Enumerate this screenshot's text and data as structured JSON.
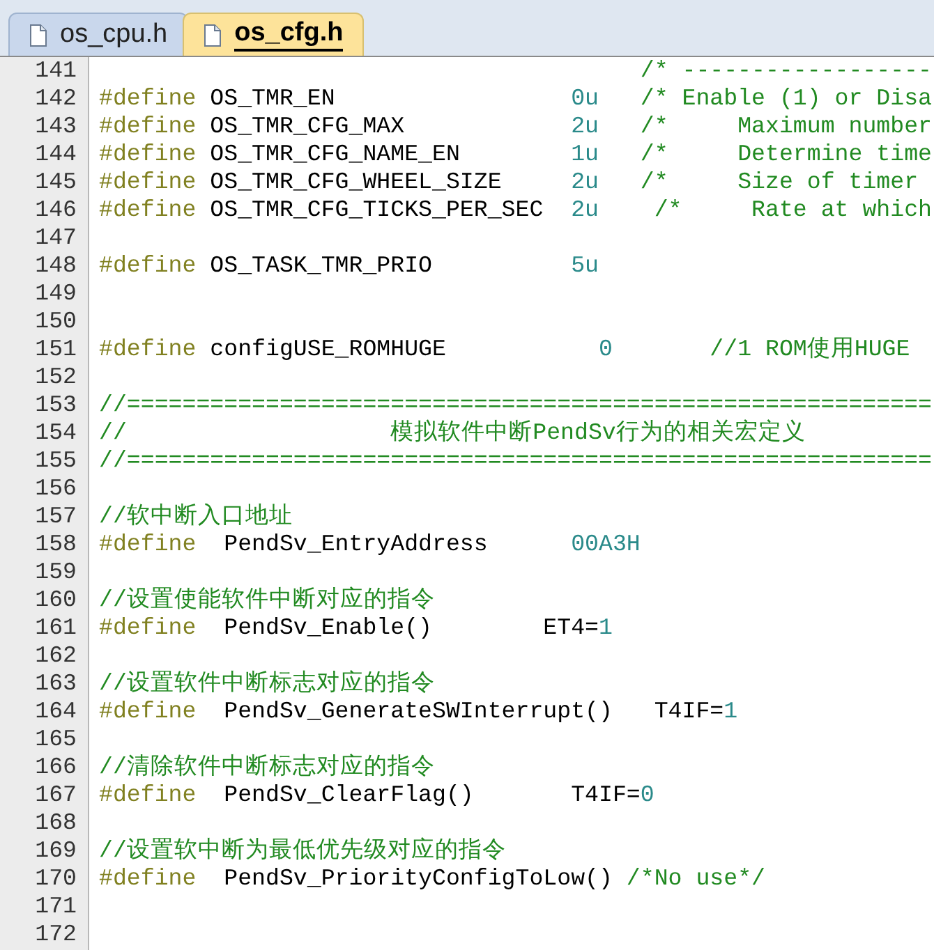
{
  "tabs": [
    {
      "label": "os_cpu.h",
      "selected": false
    },
    {
      "label": "os_cfg.h",
      "selected": true
    }
  ],
  "lines": [
    {
      "number": "141",
      "tokens": [
        {
          "kind": "comment",
          "text": "                                       /* ------------------"
        }
      ]
    },
    {
      "number": "142",
      "tokens": [
        {
          "kind": "keyword",
          "text": "#define"
        },
        {
          "kind": "plain",
          "text": " OS_TMR_EN                 "
        },
        {
          "kind": "number",
          "text": "0u"
        },
        {
          "kind": "comment",
          "text": "   /* Enable (1) or Disa"
        }
      ]
    },
    {
      "number": "143",
      "tokens": [
        {
          "kind": "keyword",
          "text": "#define"
        },
        {
          "kind": "plain",
          "text": " OS_TMR_CFG_MAX            "
        },
        {
          "kind": "number",
          "text": "2u"
        },
        {
          "kind": "comment",
          "text": "   /*     Maximum number"
        }
      ]
    },
    {
      "number": "144",
      "tokens": [
        {
          "kind": "keyword",
          "text": "#define"
        },
        {
          "kind": "plain",
          "text": " OS_TMR_CFG_NAME_EN        "
        },
        {
          "kind": "number",
          "text": "1u"
        },
        {
          "kind": "comment",
          "text": "   /*     Determine time"
        }
      ]
    },
    {
      "number": "145",
      "tokens": [
        {
          "kind": "keyword",
          "text": "#define"
        },
        {
          "kind": "plain",
          "text": " OS_TMR_CFG_WHEEL_SIZE     "
        },
        {
          "kind": "number",
          "text": "2u"
        },
        {
          "kind": "comment",
          "text": "   /*     Size of timer"
        }
      ]
    },
    {
      "number": "146",
      "tokens": [
        {
          "kind": "keyword",
          "text": "#define"
        },
        {
          "kind": "plain",
          "text": " OS_TMR_CFG_TICKS_PER_SEC  "
        },
        {
          "kind": "number",
          "text": "2u"
        },
        {
          "kind": "comment",
          "text": "    /*     Rate at which"
        }
      ]
    },
    {
      "number": "147"
    },
    {
      "number": "148",
      "tokens": [
        {
          "kind": "keyword",
          "text": "#define"
        },
        {
          "kind": "plain",
          "text": " OS_TASK_TMR_PRIO          "
        },
        {
          "kind": "number",
          "text": "5u"
        }
      ]
    },
    {
      "number": "149"
    },
    {
      "number": "150"
    },
    {
      "number": "151",
      "tokens": [
        {
          "kind": "keyword",
          "text": "#define"
        },
        {
          "kind": "plain",
          "text": " configUSE_ROMHUGE           "
        },
        {
          "kind": "number",
          "text": "0"
        },
        {
          "kind": "comment",
          "text": "       //1 ROM使用HUGE"
        }
      ]
    },
    {
      "number": "152"
    },
    {
      "number": "153",
      "tokens": [
        {
          "kind": "comment",
          "text": "//=========================================================="
        }
      ]
    },
    {
      "number": "154",
      "tokens": [
        {
          "kind": "comment",
          "text": "//                   模拟软件中断PendSv行为的相关宏定义"
        }
      ]
    },
    {
      "number": "155",
      "tokens": [
        {
          "kind": "comment",
          "text": "//=========================================================="
        }
      ]
    },
    {
      "number": "156"
    },
    {
      "number": "157",
      "tokens": [
        {
          "kind": "comment",
          "text": "//软中断入口地址"
        }
      ]
    },
    {
      "number": "158",
      "tokens": [
        {
          "kind": "keyword",
          "text": "#define"
        },
        {
          "kind": "plain",
          "text": "  PendSv_EntryAddress      "
        },
        {
          "kind": "number",
          "text": "00A3H"
        }
      ]
    },
    {
      "number": "159"
    },
    {
      "number": "160",
      "tokens": [
        {
          "kind": "comment",
          "text": "//设置使能软件中断对应的指令"
        }
      ]
    },
    {
      "number": "161",
      "tokens": [
        {
          "kind": "keyword",
          "text": "#define"
        },
        {
          "kind": "plain",
          "text": "  PendSv_Enable()        ET4="
        },
        {
          "kind": "number",
          "text": "1"
        }
      ]
    },
    {
      "number": "162"
    },
    {
      "number": "163",
      "tokens": [
        {
          "kind": "comment",
          "text": "//设置软件中断标志对应的指令"
        }
      ]
    },
    {
      "number": "164",
      "tokens": [
        {
          "kind": "keyword",
          "text": "#define"
        },
        {
          "kind": "plain",
          "text": "  PendSv_GenerateSWInterrupt()   T4IF="
        },
        {
          "kind": "number",
          "text": "1"
        }
      ]
    },
    {
      "number": "165"
    },
    {
      "number": "166",
      "tokens": [
        {
          "kind": "comment",
          "text": "//清除软件中断标志对应的指令"
        }
      ]
    },
    {
      "number": "167",
      "tokens": [
        {
          "kind": "keyword",
          "text": "#define"
        },
        {
          "kind": "plain",
          "text": "  PendSv_ClearFlag()       T4IF="
        },
        {
          "kind": "number",
          "text": "0"
        }
      ]
    },
    {
      "number": "168"
    },
    {
      "number": "169",
      "tokens": [
        {
          "kind": "comment",
          "text": "//设置软中断为最低优先级对应的指令"
        }
      ]
    },
    {
      "number": "170",
      "tokens": [
        {
          "kind": "keyword",
          "text": "#define"
        },
        {
          "kind": "plain",
          "text": "  PendSv_PriorityConfigToLow() "
        },
        {
          "kind": "comment",
          "text": "/*No use*/"
        }
      ]
    },
    {
      "number": "171"
    },
    {
      "number": "172"
    }
  ]
}
